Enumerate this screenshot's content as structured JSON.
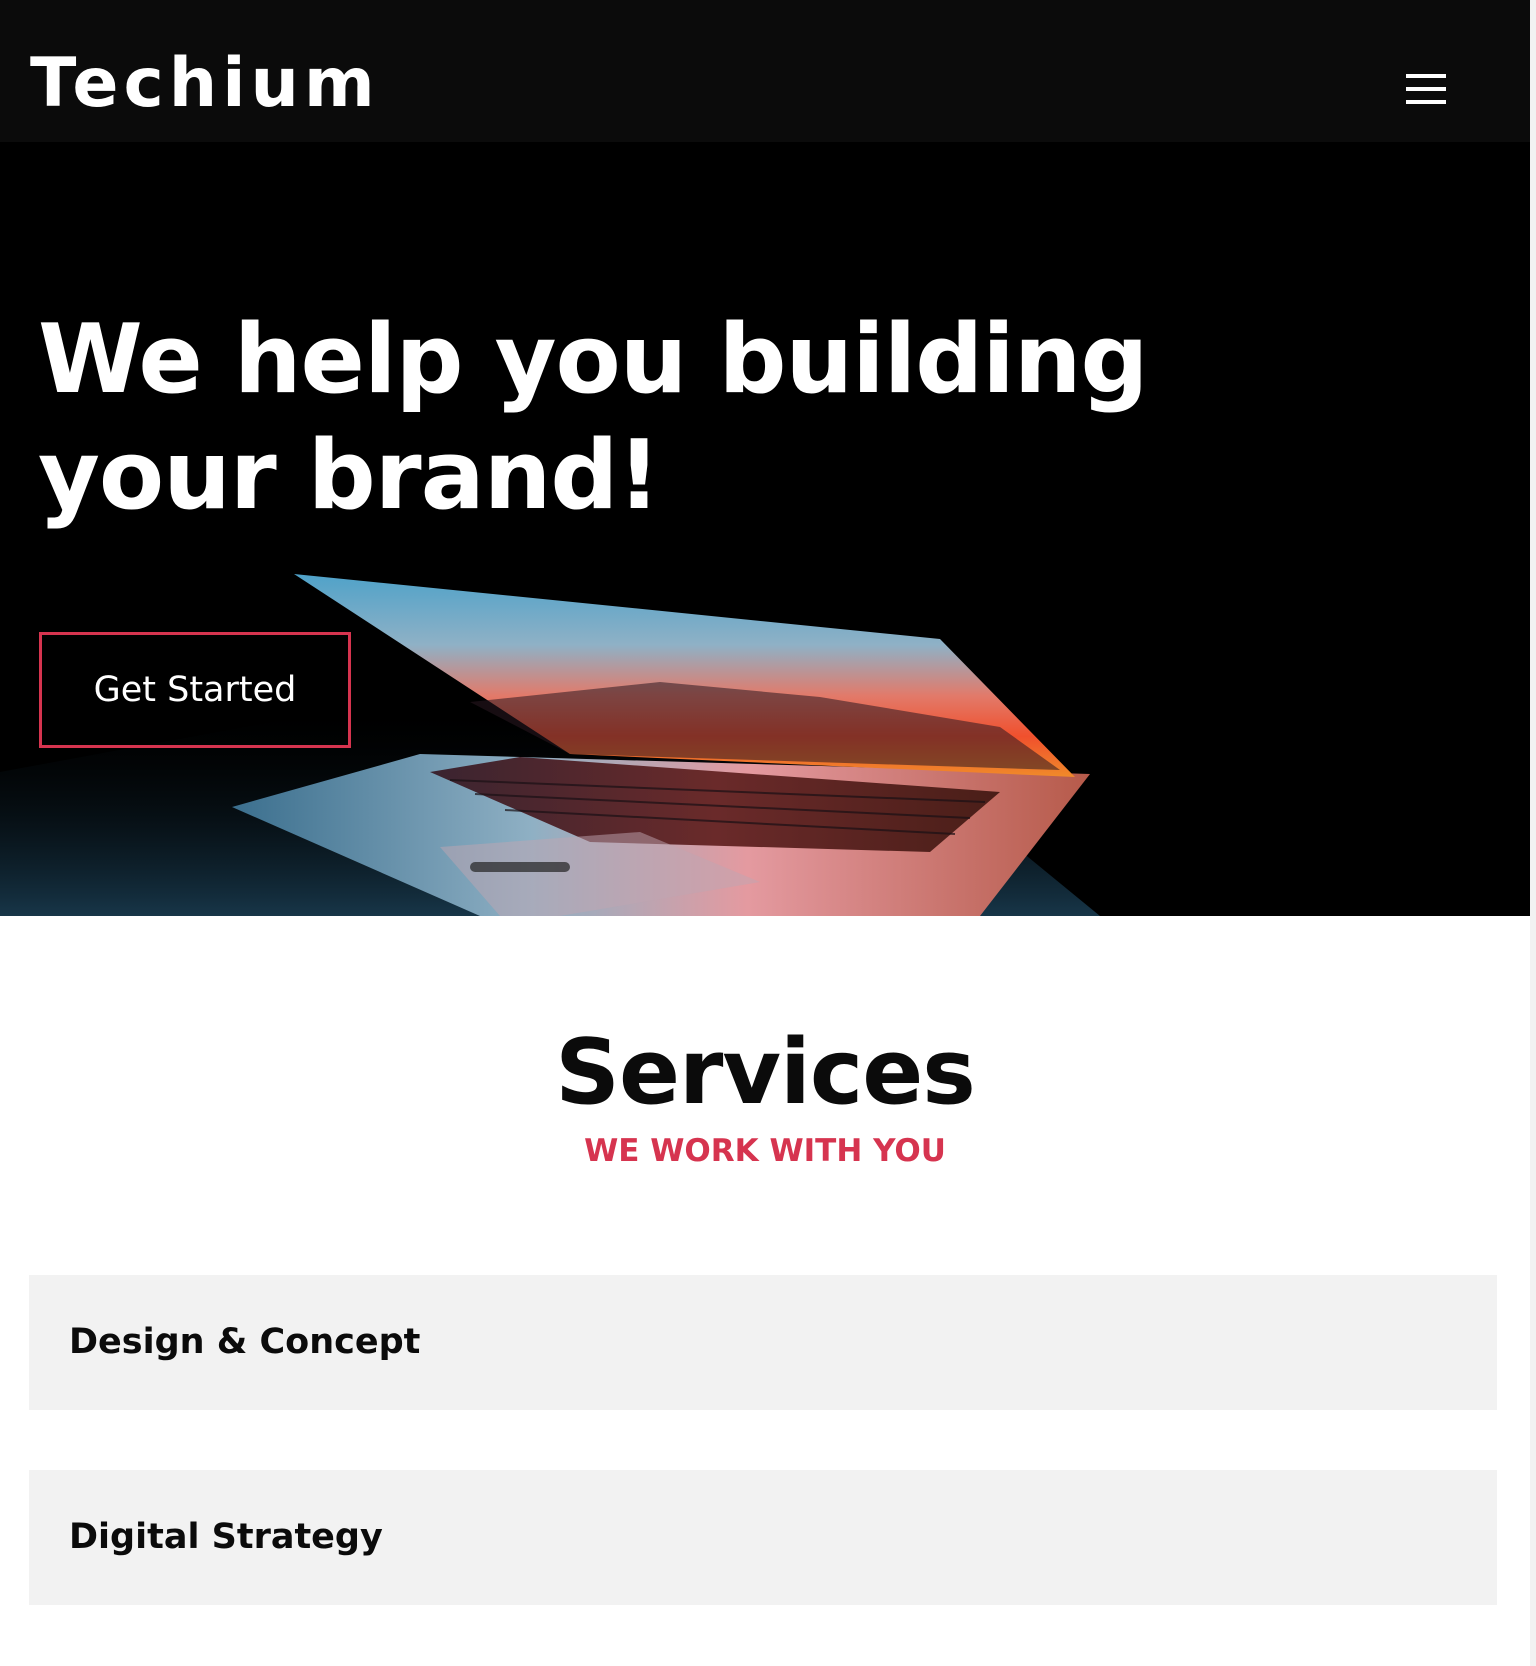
{
  "header": {
    "logo_text": "Techium",
    "menu_icon": "hamburger-menu-icon"
  },
  "hero": {
    "title": "We help you building your brand!",
    "cta_label": "Get Started",
    "image": "laptop-photo"
  },
  "services": {
    "title": "Services",
    "subtitle": "WE WORK WITH YOU",
    "items": [
      {
        "label": "Design & Concept"
      },
      {
        "label": "Digital Strategy"
      }
    ]
  },
  "colors": {
    "header_bg": "#0b0b0b",
    "hero_bg": "#000000",
    "accent": "#d6344f",
    "text_light": "#ffffff",
    "text_dark": "#0b0b0b",
    "panel_bg": "#f2f2f2"
  }
}
